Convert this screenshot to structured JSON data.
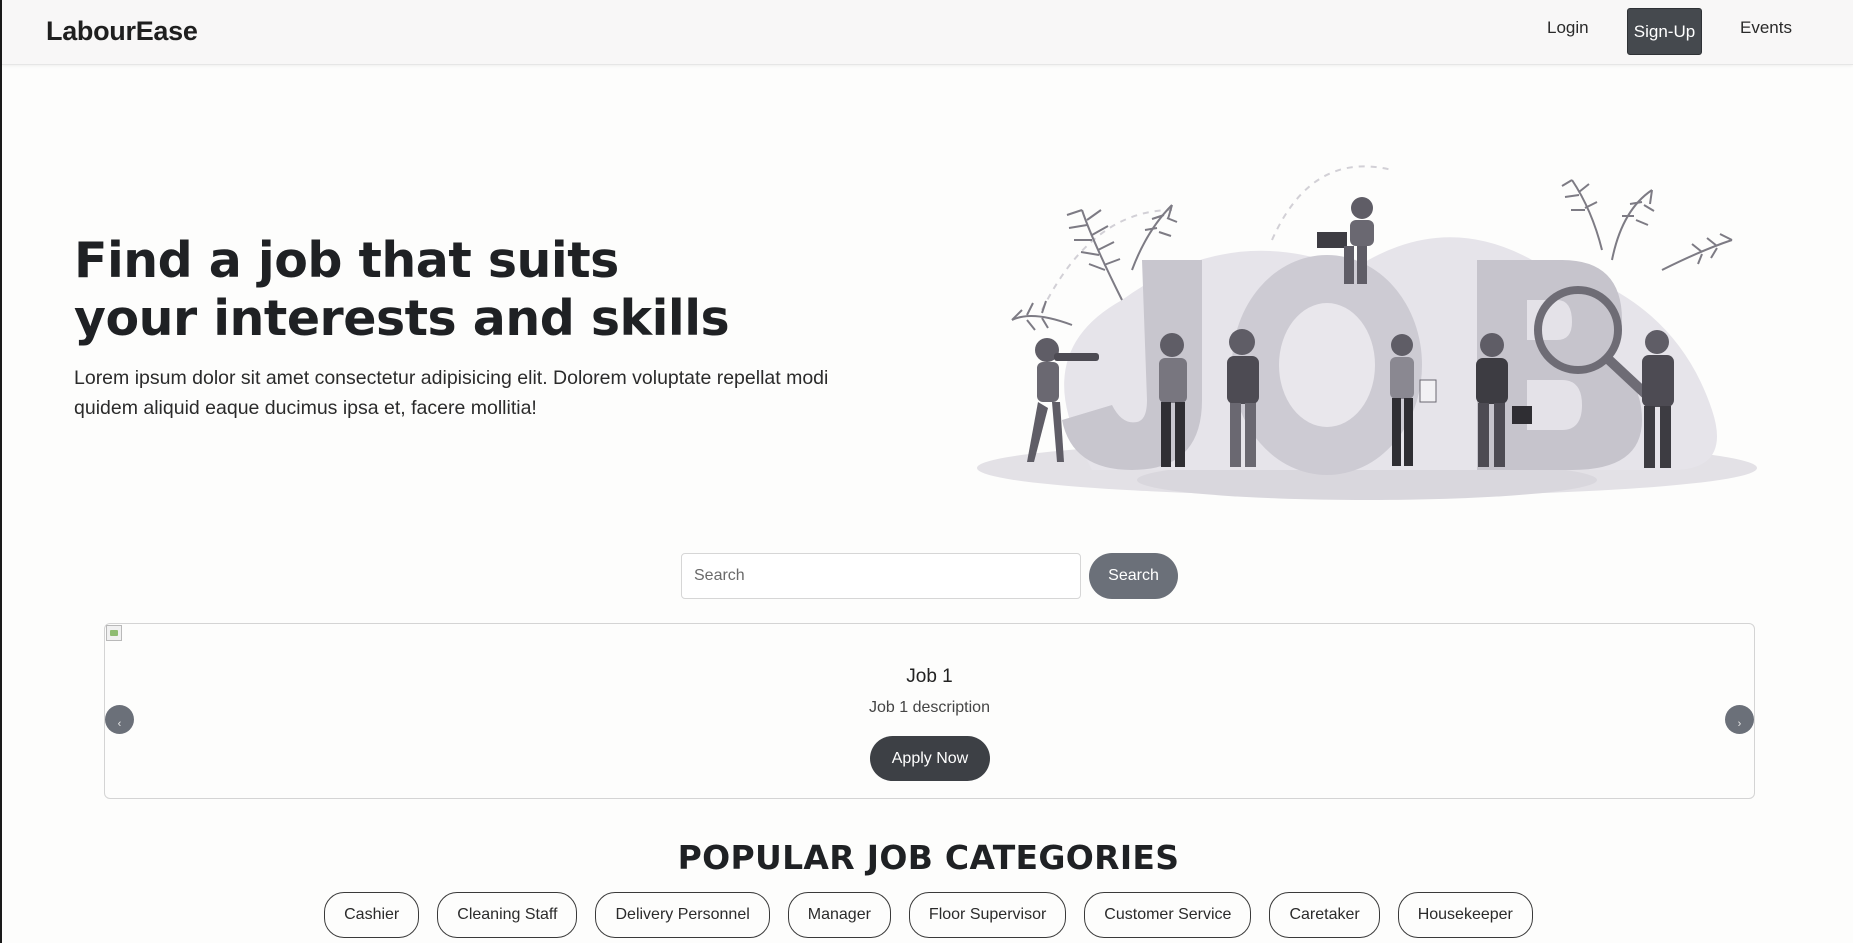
{
  "navbar": {
    "brand": "LabourEase",
    "login": "Login",
    "signup": "Sign-Up",
    "events": "Events"
  },
  "hero": {
    "title_line1": "Find a job that suits",
    "title_line2": "your interests and skills",
    "description": "Lorem ipsum dolor sit amet consectetur adipisicing elit. Dolorem voluptate repellat modi quidem aliquid eaque ducimus ipsa et, facere mollitia!",
    "illustration": "job-search-illustration"
  },
  "search": {
    "placeholder": "Search",
    "value": "",
    "button_label": "Search"
  },
  "carousel": {
    "job_title": "Job 1",
    "job_description": "Job 1 description",
    "apply_label": "Apply Now",
    "prev_icon": "‹",
    "next_icon": "›"
  },
  "categories": {
    "heading": "POPULAR JOB CATEGORIES",
    "items": [
      "Cashier",
      "Cleaning Staff",
      "Delivery Personnel",
      "Manager",
      "Floor Supervisor",
      "Customer Service",
      "Caretaker",
      "Housekeeper"
    ]
  },
  "colors": {
    "signup_bg": "#45494e",
    "search_button_bg": "#6b7079",
    "apply_bg": "#3d4045",
    "illustration_tone": "#c9c7cf"
  }
}
